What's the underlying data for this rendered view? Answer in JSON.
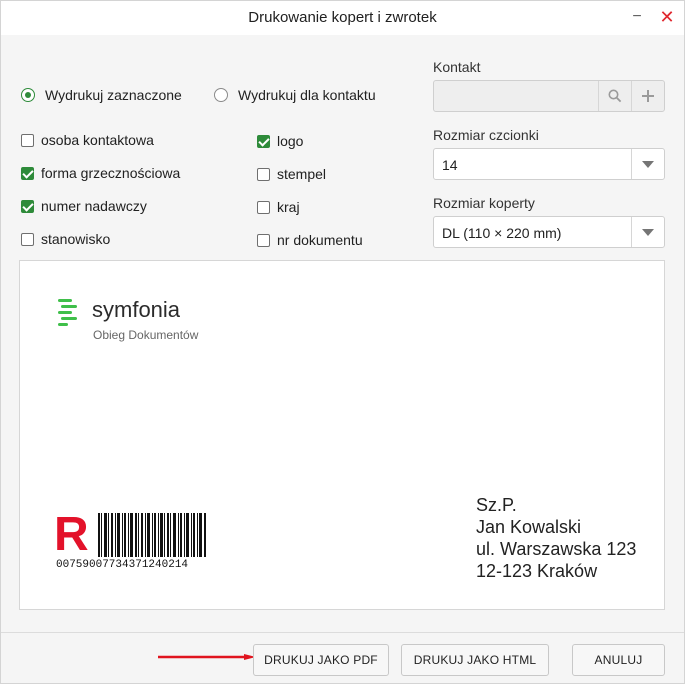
{
  "dialog": {
    "title": "Drukowanie kopert i zwrotek"
  },
  "titlebar": {
    "minimize_glyph": "−",
    "close_glyph": "✕"
  },
  "mode": {
    "options": [
      {
        "label": "Wydrukuj zaznaczone",
        "selected": true
      },
      {
        "label": "Wydrukuj dla kontaktu",
        "selected": false
      }
    ]
  },
  "checkboxes": {
    "col1": [
      {
        "label": "osoba kontaktowa",
        "checked": false
      },
      {
        "label": "forma grzecznościowa",
        "checked": true
      },
      {
        "label": "numer nadawczy",
        "checked": true
      },
      {
        "label": "stanowisko",
        "checked": false
      }
    ],
    "col2": [
      {
        "label": "logo",
        "checked": true
      },
      {
        "label": "stempel",
        "checked": false
      },
      {
        "label": "kraj",
        "checked": false
      },
      {
        "label": "nr dokumentu",
        "checked": false
      }
    ]
  },
  "contact": {
    "label": "Kontakt",
    "value": "",
    "icons": [
      "search-icon",
      "plus-icon"
    ]
  },
  "font_size": {
    "label": "Rozmiar czcionki",
    "value": "14"
  },
  "envelope_size": {
    "label": "Rozmiar koperty",
    "value": "DL (110 × 220 mm)"
  },
  "preview": {
    "brand": "symfonia",
    "brand_sub": "Obieg Dokumentów",
    "registered_mark": "R",
    "barcode_number": "00759007734371240214",
    "address": [
      "Sz.P.",
      "Jan Kowalski",
      "ul. Warszawska 123",
      "12-123 Kraków"
    ],
    "brand_color": "#3fbf4a",
    "mark_color": "#e3122a"
  },
  "buttons": {
    "print_pdf": "DRUKUJ JAKO PDF",
    "print_html": "DRUKUJ JAKO HTML",
    "cancel": "ANULUJ"
  },
  "colors": {
    "accent": "#2e8b3a",
    "annotation_arrow": "#e0141e"
  }
}
